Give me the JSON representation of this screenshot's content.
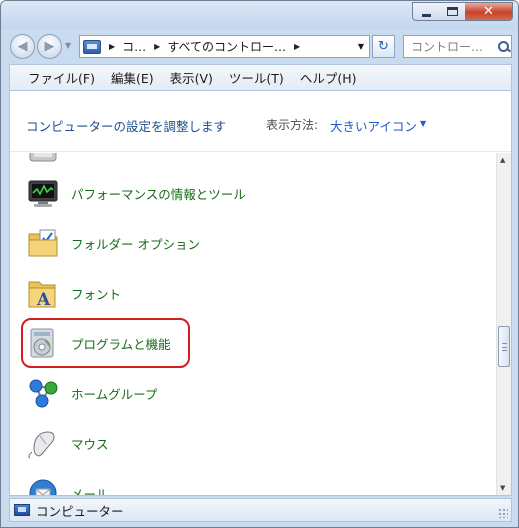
{
  "window": {
    "caption_min": "minimize",
    "caption_max": "maximize",
    "caption_close": "close"
  },
  "nav": {
    "back_icon": "back-arrow-icon",
    "forward_icon": "forward-arrow-icon",
    "breadcrumbs": [
      "コ…",
      "すべてのコントロー…"
    ],
    "search_placeholder": "コントロー…"
  },
  "menu": {
    "items": [
      "ファイル(F)",
      "編集(E)",
      "表示(V)",
      "ツール(T)",
      "ヘルプ(H)"
    ]
  },
  "header": {
    "title": "コンピューターの設定を調整します",
    "view_by_label": "表示方法:",
    "view_by_value": "大きいアイコン"
  },
  "items": [
    {
      "label": "",
      "icon": "partial-icon"
    },
    {
      "label": "パフォーマンスの情報とツール",
      "icon": "performance-monitor-icon"
    },
    {
      "label": "フォルダー オプション",
      "icon": "folder-options-icon"
    },
    {
      "label": "フォント",
      "icon": "fonts-folder-icon"
    },
    {
      "label": "プログラムと機能",
      "icon": "programs-features-icon"
    },
    {
      "label": "ホームグループ",
      "icon": "homegroup-icon"
    },
    {
      "label": "マウス",
      "icon": "mouse-icon"
    },
    {
      "label": "メール",
      "icon": "mail-icon"
    }
  ],
  "highlighted_item": "プログラムと機能",
  "status": {
    "text": "コンピューター"
  },
  "colors": {
    "item_link": "#166b16",
    "header_title": "#1c4d8f",
    "view_by_value": "#1d5bc6",
    "highlight": "#d41e1e",
    "window_frame": "#c9dbee"
  }
}
